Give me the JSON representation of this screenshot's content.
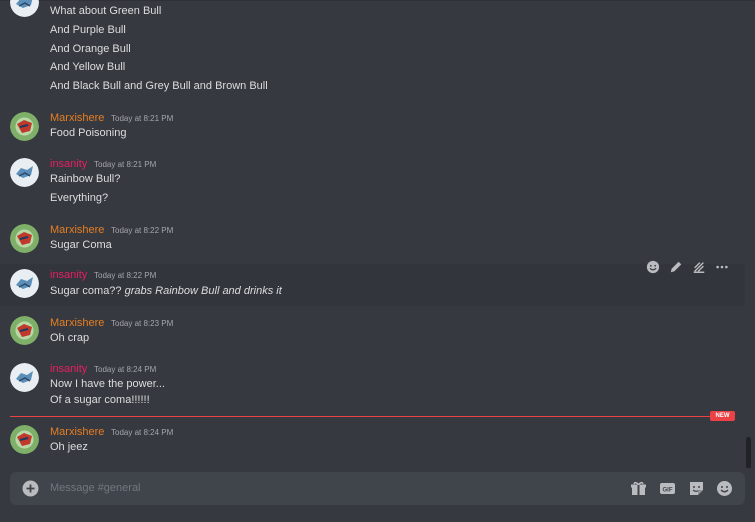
{
  "chat": {
    "first_group_lines": [
      "What about Green Bull",
      "And Purple Bull",
      "And Orange Bull",
      "And Yellow Bull",
      "And Black Bull and Grey Bull and Brown Bull"
    ],
    "messages": [
      {
        "author": "Marxishere",
        "timestamp": "Today at 8:21 PM",
        "lines": [
          "Food Poisoning"
        ]
      },
      {
        "author": "insanity",
        "timestamp": "Today at 8:21 PM",
        "lines": [
          "Rainbow Bull?",
          "Everything?"
        ]
      },
      {
        "author": "Marxishere",
        "timestamp": "Today at 8:22 PM",
        "lines": [
          "Sugar Coma"
        ]
      },
      {
        "author": "insanity",
        "timestamp": "Today at 8:22 PM",
        "prefix": "Sugar coma??",
        "italic": "grabs Rainbow Bull and drinks it"
      },
      {
        "author": "Marxishere",
        "timestamp": "Today at 8:23 PM",
        "lines": [
          "Oh crap"
        ]
      },
      {
        "author": "insanity",
        "timestamp": "Today at 8:24 PM",
        "lines": [
          "Now I have the power...",
          "Of a sugar coma!!!!!!"
        ]
      },
      {
        "author": "Marxishere",
        "timestamp": "Today at 8:24 PM",
        "lines": [
          "Oh jeez"
        ]
      }
    ],
    "new_badge": "NEW"
  },
  "composer": {
    "placeholder": "Message #general",
    "gif_label": "GIF"
  },
  "colors": {
    "background": "#36393f",
    "marxishere": "#e67e22",
    "insanity": "#e91e63",
    "new_divider": "#ed4245"
  },
  "icons": {
    "toolbar": [
      "add-reaction-icon",
      "edit-icon",
      "thread-icon",
      "more-icon"
    ],
    "composer": [
      "add-attachment-icon",
      "gift-icon",
      "gif-icon",
      "sticker-icon",
      "emoji-icon"
    ]
  }
}
